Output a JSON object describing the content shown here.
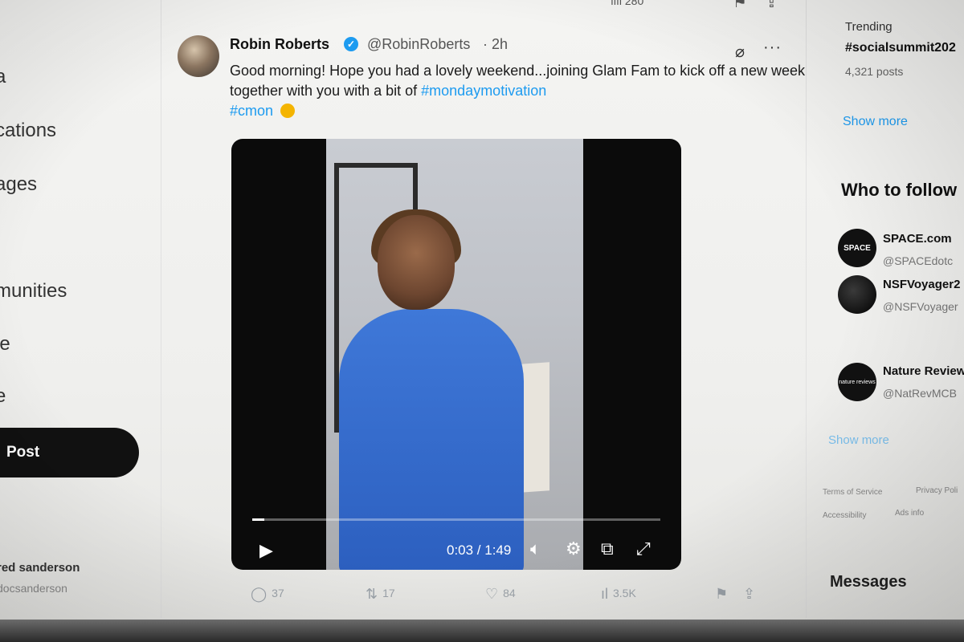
{
  "nav": {
    "items": [
      {
        "label": "a"
      },
      {
        "label": "cations"
      },
      {
        "label": "ages"
      },
      {
        "label": "munities"
      },
      {
        "label": "le"
      },
      {
        "label": "e"
      }
    ],
    "post_label": "Post",
    "account_name": "red sanderson",
    "account_handle": "docsanderson"
  },
  "prev_tweet": {
    "views": "280"
  },
  "tweet": {
    "author_name": "Robin Roberts",
    "author_handle": "@RobinRoberts",
    "separator": "·",
    "timestamp": "2h",
    "text_main": "Good morning! Hope you had a lovely weekend...joining Glam Fam to kick off a new week together with you with a bit of ",
    "hashtag_1": "#mondaymotivation",
    "hashtag_2": "#cmon",
    "video": {
      "time_display": "0:03 / 1:49",
      "progress": 0.03
    },
    "actions": {
      "replies": "37",
      "reposts": "17",
      "likes": "84",
      "views": "3.5K"
    }
  },
  "sidebar": {
    "trending_label": "Trending",
    "trending_tag": "#socialsummit202",
    "trending_count": "4,321 posts",
    "show_more_1": "Show more",
    "who_to_follow_title": "Who to follow",
    "follow": [
      {
        "name": "SPACE.com",
        "handle": "@SPACEdotc",
        "avatar_text": "SPACE"
      },
      {
        "name": "NSFVoyager2",
        "handle": "@NSFVoyager",
        "avatar_text": ""
      },
      {
        "name": "Nature Review",
        "handle": "@NatRevMCB",
        "avatar_text": "nature reviews"
      }
    ],
    "show_more_2": "Show more",
    "footer": {
      "terms": "Terms of Service",
      "privacy": "Privacy Poli",
      "accessibility": "Accessibility",
      "ads": "Ads info"
    },
    "messages_title": "Messages"
  },
  "colors": {
    "accent": "#1d9bf0",
    "post_button": "#111111"
  }
}
